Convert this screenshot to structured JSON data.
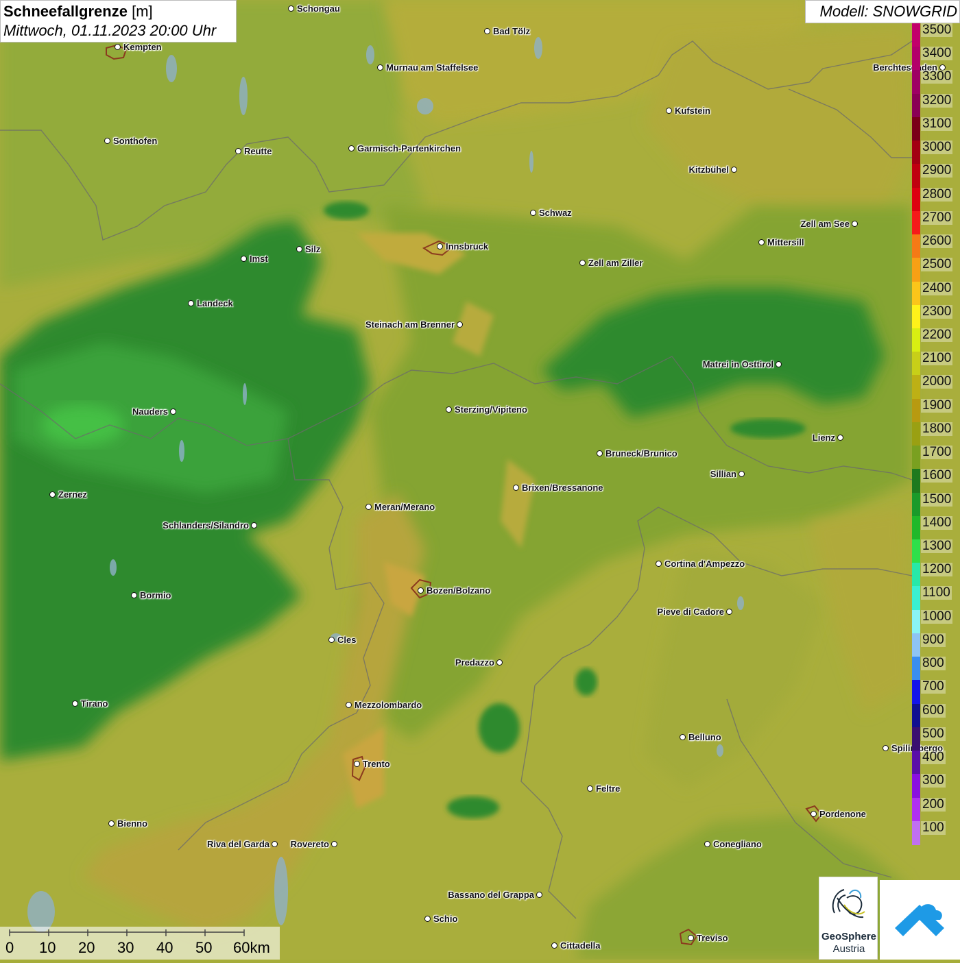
{
  "title": {
    "main": "Schneefallgrenze",
    "unit": "[m]",
    "datetime": "Mittwoch, 01.11.2023 20:00 Uhr"
  },
  "model": "Modell: SNOWGRID",
  "legend": [
    {
      "label": "3500",
      "color": "#c2006b"
    },
    {
      "label": "3400",
      "color": "#b3006a"
    },
    {
      "label": "3300",
      "color": "#9e0064"
    },
    {
      "label": "3200",
      "color": "#8a0055"
    },
    {
      "label": "3100",
      "color": "#7a0018"
    },
    {
      "label": "3000",
      "color": "#a30012"
    },
    {
      "label": "2900",
      "color": "#c0000f"
    },
    {
      "label": "2800",
      "color": "#dd0010"
    },
    {
      "label": "2700",
      "color": "#f51a1a"
    },
    {
      "label": "2600",
      "color": "#f57a16"
    },
    {
      "label": "2500",
      "color": "#f7a015"
    },
    {
      "label": "2400",
      "color": "#fbc51a"
    },
    {
      "label": "2300",
      "color": "#fff21a"
    },
    {
      "label": "2200",
      "color": "#d8ef12"
    },
    {
      "label": "2100",
      "color": "#c8cf18"
    },
    {
      "label": "2000",
      "color": "#bdb015"
    },
    {
      "label": "1900",
      "color": "#b89a10"
    },
    {
      "label": "1800",
      "color": "#9aa012"
    },
    {
      "label": "1700",
      "color": "#7aa020"
    },
    {
      "label": "1600",
      "color": "#1e7a1e"
    },
    {
      "label": "1500",
      "color": "#1a9a2a"
    },
    {
      "label": "1400",
      "color": "#20b82a"
    },
    {
      "label": "1300",
      "color": "#2ee04a"
    },
    {
      "label": "1200",
      "color": "#28e8a8"
    },
    {
      "label": "1100",
      "color": "#3af0d0"
    },
    {
      "label": "1000",
      "color": "#8af4f4"
    },
    {
      "label": "900",
      "color": "#8ec4f4"
    },
    {
      "label": "800",
      "color": "#3a8ef0"
    },
    {
      "label": "700",
      "color": "#1414e8"
    },
    {
      "label": "600",
      "color": "#101090"
    },
    {
      "label": "500",
      "color": "#3a1070"
    },
    {
      "label": "400",
      "color": "#5a10a8"
    },
    {
      "label": "300",
      "color": "#8a10e0"
    },
    {
      "label": "200",
      "color": "#b030f0"
    },
    {
      "label": "100",
      "color": "#c070f0"
    }
  ],
  "cities": [
    {
      "name": "Schongau"
    },
    {
      "name": "Bad Tölz"
    },
    {
      "name": "Kempten"
    },
    {
      "name": "Murnau am Staffelsee"
    },
    {
      "name": "Berchtesgaden"
    },
    {
      "name": "Kufstein"
    },
    {
      "name": "Sonthofen"
    },
    {
      "name": "Reutte"
    },
    {
      "name": "Garmisch-Partenkirchen"
    },
    {
      "name": "Kitzbühel"
    },
    {
      "name": "Schwaz"
    },
    {
      "name": "Zell am See"
    },
    {
      "name": "Innsbruck"
    },
    {
      "name": "Mittersill"
    },
    {
      "name": "Silz"
    },
    {
      "name": "Imst"
    },
    {
      "name": "Zell am Ziller"
    },
    {
      "name": "Landeck"
    },
    {
      "name": "Steinach am Brenner"
    },
    {
      "name": "Matrei in Osttirol"
    },
    {
      "name": "Nauders"
    },
    {
      "name": "Sterzing/Vipiteno"
    },
    {
      "name": "Lienz"
    },
    {
      "name": "Bruneck/Brunico"
    },
    {
      "name": "Sillian"
    },
    {
      "name": "Brixen/Bressanone"
    },
    {
      "name": "Zernez"
    },
    {
      "name": "Meran/Merano"
    },
    {
      "name": "Schlanders/Silandro"
    },
    {
      "name": "Cortina d'Ampezzo"
    },
    {
      "name": "Bozen/Bolzano"
    },
    {
      "name": "Bormio"
    },
    {
      "name": "Pieve di Cadore"
    },
    {
      "name": "Cles"
    },
    {
      "name": "Predazzo"
    },
    {
      "name": "Tirano"
    },
    {
      "name": "Mezzolombardo"
    },
    {
      "name": "Belluno"
    },
    {
      "name": "Spilimbergo"
    },
    {
      "name": "Trento"
    },
    {
      "name": "Feltre"
    },
    {
      "name": "Pordenone"
    },
    {
      "name": "Bienno"
    },
    {
      "name": "Riva del Garda"
    },
    {
      "name": "Rovereto"
    },
    {
      "name": "Conegliano"
    },
    {
      "name": "Bassano del Grappa"
    },
    {
      "name": "Schio"
    },
    {
      "name": "Treviso"
    },
    {
      "name": "Cittadella"
    }
  ],
  "scale": [
    "0",
    "10",
    "20",
    "30",
    "40",
    "50",
    "60km"
  ],
  "logos": {
    "geosphere_name": "GeoSphere",
    "geosphere_sub": "Austria"
  }
}
